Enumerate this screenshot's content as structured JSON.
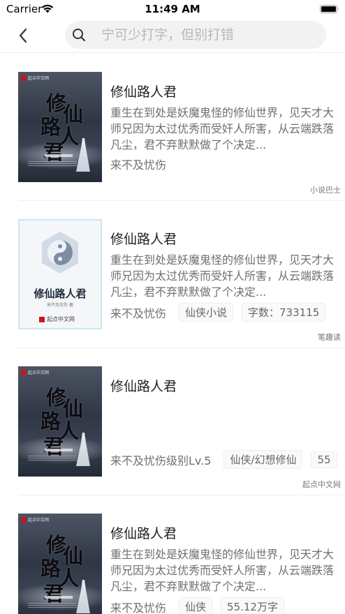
{
  "status_bar": {
    "carrier": "Carrier",
    "time": "11:49 AM",
    "icons": [
      "wifi-icon",
      "battery-icon"
    ]
  },
  "nav": {
    "back_icon": "chevron-left-icon",
    "search_icon": "search-icon",
    "search_placeholder": "宁可少打字，但别打错",
    "search_value": ""
  },
  "colors": {
    "background": "#ffffff",
    "search_bg": "#f2f2f2",
    "text_primary": "#222222",
    "text_secondary": "#6f6f6f",
    "divider": "#efefef"
  },
  "books": [
    {
      "cover": "dark",
      "title": "修仙路人君",
      "description": "重生在到处是妖魔鬼怪的修仙世界，见天才大师兄因为太过优秀而受奸人所害，从云端跌落凡尘，君不弃默默做了个决定...",
      "author": "来不及忧伤",
      "tags": [],
      "source": "小说巴士"
    },
    {
      "cover": "light",
      "title": "修仙路人君",
      "description": "重生在到处是妖魔鬼怪的修仙世界，见天才大师兄因为太过优秀而受奸人所害，从云端跌落凡尘，君不弃默默做了个决定...",
      "author": "来不及忧伤",
      "tags": [
        "仙侠小说",
        "字数：733115"
      ],
      "source": "笔趣读"
    },
    {
      "cover": "dark",
      "title": "修仙路人君",
      "description": "",
      "author": "来不及忧伤级别Lv.5",
      "tags": [
        "仙侠/幻想修仙",
        "55"
      ],
      "source": "起点中文网"
    },
    {
      "cover": "dark",
      "title": "修仙路人君",
      "description": "重生在到处是妖魔鬼怪的修仙世界，见天才大师兄因为太过优秀而受奸人所害，从云端跌落凡尘，君不弃默默做了个决定...",
      "author": "来不及忧伤",
      "tags": [
        "仙侠",
        "55.12万字"
      ],
      "source": ""
    }
  ]
}
